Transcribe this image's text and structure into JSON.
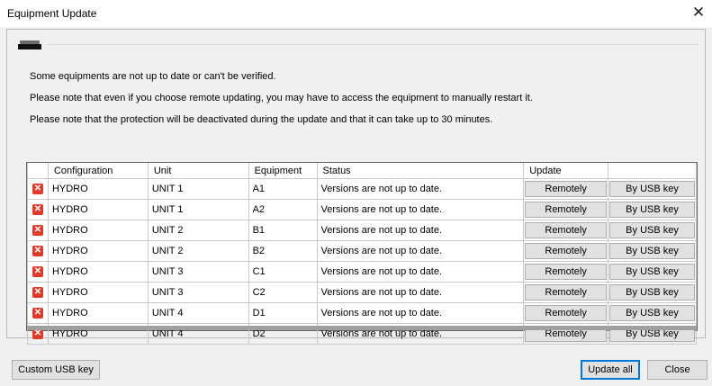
{
  "window": {
    "title": "Equipment Update",
    "close_symbol": "✕"
  },
  "messages": [
    "Some equipments are not up to date or can't be verified.",
    "Please note that even if you choose remote updating, you may have to access the equipment to manually restart it.",
    "Please note that the protection will be deactivated during the update and that it can take up to 30 minutes."
  ],
  "table": {
    "headers": [
      "",
      "Configuration",
      "Unit",
      "Equipment",
      "Status",
      "Update",
      ""
    ],
    "rows": [
      {
        "configuration": "HYDRO",
        "unit": "UNIT 1",
        "equipment": "A1",
        "status": "Versions are not up to date.",
        "remote_label": "Remotely",
        "usb_label": "By USB key"
      },
      {
        "configuration": "HYDRO",
        "unit": "UNIT 1",
        "equipment": "A2",
        "status": "Versions are not up to date.",
        "remote_label": "Remotely",
        "usb_label": "By USB key"
      },
      {
        "configuration": "HYDRO",
        "unit": "UNIT 2",
        "equipment": "B1",
        "status": "Versions are not up to date.",
        "remote_label": "Remotely",
        "usb_label": "By USB key"
      },
      {
        "configuration": "HYDRO",
        "unit": "UNIT 2",
        "equipment": "B2",
        "status": "Versions are not up to date.",
        "remote_label": "Remotely",
        "usb_label": "By USB key"
      },
      {
        "configuration": "HYDRO",
        "unit": "UNIT 3",
        "equipment": "C1",
        "status": "Versions are not up to date.",
        "remote_label": "Remotely",
        "usb_label": "By USB key"
      },
      {
        "configuration": "HYDRO",
        "unit": "UNIT 3",
        "equipment": "C2",
        "status": "Versions are not up to date.",
        "remote_label": "Remotely",
        "usb_label": "By USB key"
      },
      {
        "configuration": "HYDRO",
        "unit": "UNIT 4",
        "equipment": "D1",
        "status": "Versions are not up to date.",
        "remote_label": "Remotely",
        "usb_label": "By USB key"
      },
      {
        "configuration": "HYDRO",
        "unit": "UNIT 4",
        "equipment": "D2",
        "status": "Versions are not up to date.",
        "remote_label": "Remotely",
        "usb_label": "By USB key"
      }
    ],
    "status_icon": "error-icon",
    "error_color": "#e03a2b"
  },
  "buttons": {
    "custom_usb": "Custom USB key",
    "update_all": "Update all",
    "close": "Close"
  }
}
